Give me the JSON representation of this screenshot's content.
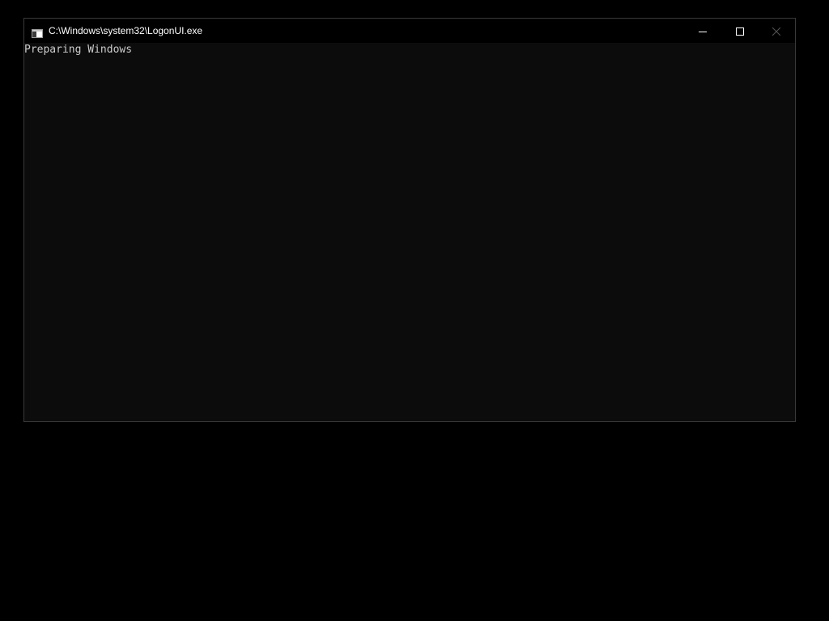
{
  "window": {
    "title": "C:\\Windows\\system32\\LogonUI.exe",
    "app_icon": "console-app-icon",
    "buttons": {
      "minimize_icon": "minimize-icon",
      "maximize_icon": "maximize-icon",
      "close_icon": "close-icon"
    }
  },
  "console": {
    "output": "Preparing Windows"
  },
  "colors": {
    "desktop_background": "#000000",
    "titlebar_background": "#000000",
    "console_background": "#0c0c0c",
    "console_text": "#cccccc",
    "window_border": "#3a3a3a"
  }
}
